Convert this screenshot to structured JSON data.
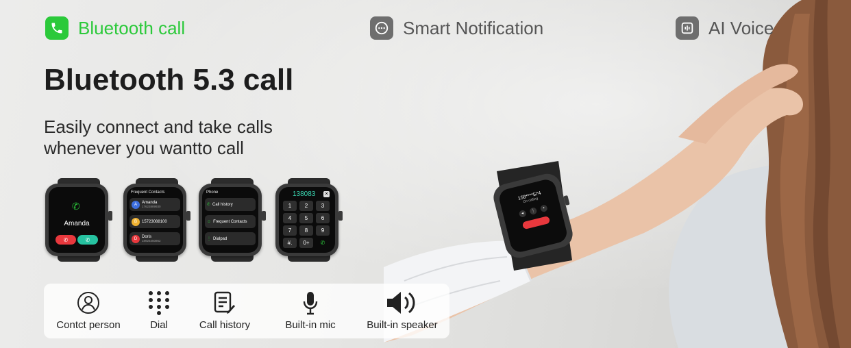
{
  "tabs": [
    {
      "label": "Bluetooth call",
      "icon": "phone-icon",
      "active": true,
      "color": "#2bc93a"
    },
    {
      "label": "Smart Notification",
      "icon": "chat-bubble-icon",
      "active": false
    },
    {
      "label": "AI Voice",
      "icon": "voice-wave-icon",
      "active": false
    }
  ],
  "title": "Bluetooth 5.3 call",
  "subtitle": {
    "line1": "Easily connect and take calls",
    "line2": "whenever you wantto call"
  },
  "watches": {
    "call": {
      "name": "Amanda"
    },
    "contacts": {
      "header": "Frequent Contacts",
      "items": [
        {
          "initial": "A",
          "name": "Amanda",
          "number": "17623889930",
          "color": "#3d6fe0"
        },
        {
          "initial": "B",
          "name": "15723088100",
          "number": "",
          "color": "#f0b232"
        },
        {
          "initial": "D",
          "name": "Doris",
          "number": "18925450862",
          "color": "#e8383d"
        }
      ]
    },
    "phone": {
      "header": "Phone",
      "items": [
        "Call history",
        "Frequent Contacts",
        "Dialpad"
      ]
    },
    "dialpad": {
      "number": "138083",
      "keys": [
        "1",
        "2",
        "3",
        "4",
        "5",
        "6",
        "7",
        "8",
        "9",
        "#.",
        "0+",
        ""
      ]
    },
    "wrist": {
      "number": "158****574",
      "status": "On calling"
    }
  },
  "features": [
    {
      "label": "Contct person",
      "icon": "person-icon"
    },
    {
      "label": "Dial",
      "icon": "dialpad-icon"
    },
    {
      "label": "Call history",
      "icon": "call-history-icon"
    },
    {
      "label": "Built-in mic",
      "icon": "microphone-icon"
    },
    {
      "label": "Built-in speaker",
      "icon": "speaker-icon"
    }
  ]
}
